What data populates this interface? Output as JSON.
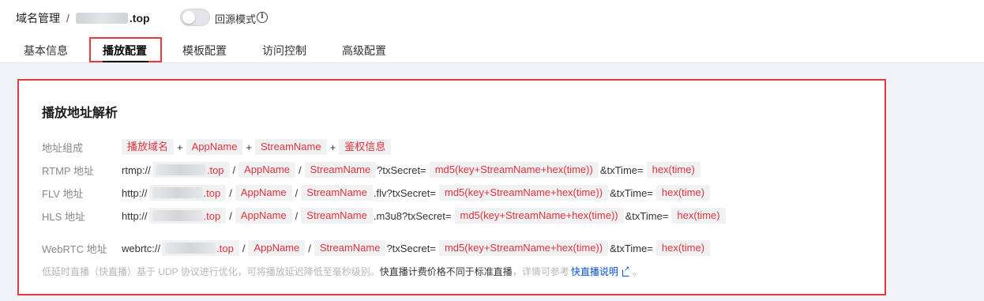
{
  "breadcrumb": {
    "root": "域名管理",
    "separator": "/",
    "domain_suffix": ".top"
  },
  "header": {
    "toggle_label": "回源模式",
    "info_glyph": "i"
  },
  "tabs": [
    {
      "label": "基本信息"
    },
    {
      "label": "播放配置"
    },
    {
      "label": "模板配置"
    },
    {
      "label": "访问控制"
    },
    {
      "label": "高级配置"
    }
  ],
  "panel": {
    "title": "播放地址解析",
    "composition": {
      "label": "地址组成",
      "parts": [
        "播放域名",
        "AppName",
        "StreamName",
        "鉴权信息"
      ],
      "plus": "+"
    },
    "rtmp": {
      "label": "RTMP 地址",
      "scheme": "rtmp://",
      "suffix": ".top",
      "sep": "/",
      "app": "AppName",
      "stream": "StreamName",
      "query": "?txSecret=",
      "secret": "md5(key+StreamName+hex(time))",
      "time_key": "&txTime=",
      "time": "hex(time)"
    },
    "flv": {
      "label": "FLV 地址",
      "scheme": "http://",
      "suffix": ".top",
      "sep": "/",
      "app": "AppName",
      "stream": "StreamName",
      "query": ".flv?txSecret=",
      "secret": "md5(key+StreamName+hex(time))",
      "time_key": "&txTime=",
      "time": "hex(time)"
    },
    "hls": {
      "label": "HLS 地址",
      "scheme": "http://",
      "suffix": ".top",
      "sep": "/",
      "app": "AppName",
      "stream": "StreamName",
      "query": ".m3u8?txSecret=",
      "secret": "md5(key+StreamName+hex(time))",
      "time_key": "&txTime=",
      "time": "hex(time)"
    },
    "webrtc": {
      "label": "WebRTC 地址",
      "scheme": "webrtc://",
      "suffix": ".top",
      "sep": "/",
      "app": "AppName",
      "stream": "StreamName",
      "query": "?txSecret=",
      "secret": "md5(key+StreamName+hex(time))",
      "time_key": "&txTime=",
      "time": "hex(time)"
    },
    "note": {
      "text": "低延时直播（快直播）基于 UDP 协议进行优化，可将播放延迟降低至毫秒级别。",
      "bold": "快直播计费价格不同于标准直播",
      "more": "，详情可参考",
      "link": "快直播说明",
      "end": "。"
    }
  },
  "colors": {
    "accent_red": "#e8393e",
    "tag_text": "#e0333a",
    "link_blue": "#0052d9"
  }
}
